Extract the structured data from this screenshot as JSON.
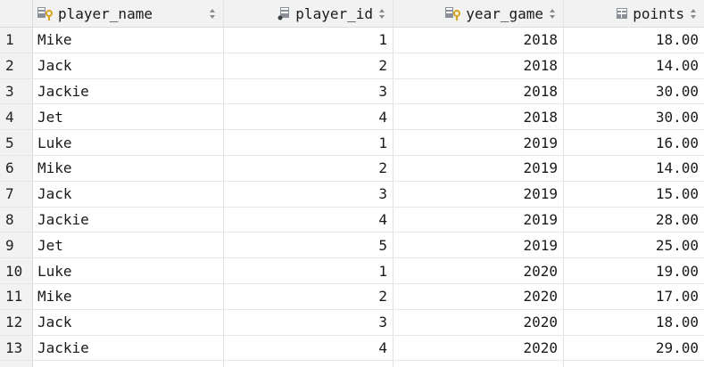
{
  "table": {
    "columns": [
      {
        "label": "player_name",
        "icon": "key-column-icon"
      },
      {
        "label": "player_id",
        "icon": "column-icon"
      },
      {
        "label": "year_game",
        "icon": "key-column-icon"
      },
      {
        "label": "points",
        "icon": "column-icon"
      }
    ],
    "rows": [
      {
        "num": "1",
        "player_name": "Mike",
        "player_id": "1",
        "year_game": "2018",
        "points": "18.00"
      },
      {
        "num": "2",
        "player_name": "Jack",
        "player_id": "2",
        "year_game": "2018",
        "points": "14.00"
      },
      {
        "num": "3",
        "player_name": "Jackie",
        "player_id": "3",
        "year_game": "2018",
        "points": "30.00"
      },
      {
        "num": "4",
        "player_name": "Jet",
        "player_id": "4",
        "year_game": "2018",
        "points": "30.00"
      },
      {
        "num": "5",
        "player_name": "Luke",
        "player_id": "1",
        "year_game": "2019",
        "points": "16.00"
      },
      {
        "num": "6",
        "player_name": "Mike",
        "player_id": "2",
        "year_game": "2019",
        "points": "14.00"
      },
      {
        "num": "7",
        "player_name": "Jack",
        "player_id": "3",
        "year_game": "2019",
        "points": "15.00"
      },
      {
        "num": "8",
        "player_name": "Jackie",
        "player_id": "4",
        "year_game": "2019",
        "points": "28.00"
      },
      {
        "num": "9",
        "player_name": "Jet",
        "player_id": "5",
        "year_game": "2019",
        "points": "25.00"
      },
      {
        "num": "10",
        "player_name": "Luke",
        "player_id": "1",
        "year_game": "2020",
        "points": "19.00"
      },
      {
        "num": "11",
        "player_name": "Mike",
        "player_id": "2",
        "year_game": "2020",
        "points": "17.00"
      },
      {
        "num": "12",
        "player_name": "Jack",
        "player_id": "3",
        "year_game": "2020",
        "points": "18.00"
      },
      {
        "num": "13",
        "player_name": "Jackie",
        "player_id": "4",
        "year_game": "2020",
        "points": "29.00"
      }
    ]
  },
  "colors": {
    "header_bg": "#f2f2f2",
    "key_icon": "#d9a21b",
    "column_icon": "#8a8f98"
  }
}
